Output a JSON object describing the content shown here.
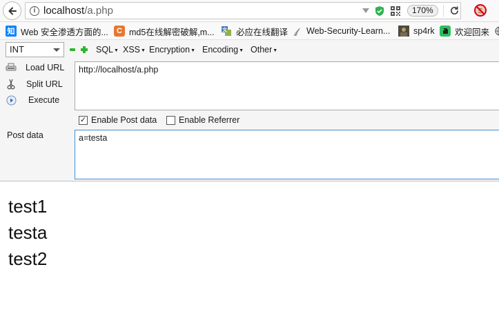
{
  "navbar": {
    "url_host": "localhost",
    "url_path": "/a.php",
    "zoom": "170%"
  },
  "bookmarks": [
    {
      "label": "Web 安全渗透方面的...",
      "icon": "zhihu-icon",
      "icon_text": "知",
      "icon_color": "#0a84ff"
    },
    {
      "label": "md5在线解密破解,m...",
      "icon": "cmd5-icon",
      "icon_text": "C",
      "icon_color": "#e8772e"
    },
    {
      "label": "必应在线翻译",
      "icon": "bing-translate-icon",
      "icon_text": "",
      "icon_color": "#4a7ab8"
    },
    {
      "label": "Web-Security-Learn...",
      "icon": "github-icon",
      "icon_text": "",
      "icon_color": "#555555"
    },
    {
      "label": "sp4rk",
      "icon": "avatar-icon",
      "icon_text": "",
      "icon_color": "#3b3b3b"
    },
    {
      "label": "欢迎回来",
      "icon": "evernote-icon",
      "icon_text": "",
      "icon_color": "#2dbe60"
    }
  ],
  "hackbar": {
    "select_value": "INT",
    "menus": [
      "SQL",
      "XSS",
      "Encryption",
      "Encoding",
      "Other"
    ],
    "actions": {
      "load": "Load URL",
      "split": "Split URL",
      "execute": "Execute"
    },
    "url_value": "http://localhost/a.php",
    "enable_post_label": "Enable Post data",
    "enable_post_checked": "✓",
    "enable_referrer_label": "Enable Referrer",
    "post_label": "Post data",
    "post_value": "a=testa"
  },
  "page_output": [
    "test1",
    "testa",
    "test2"
  ]
}
